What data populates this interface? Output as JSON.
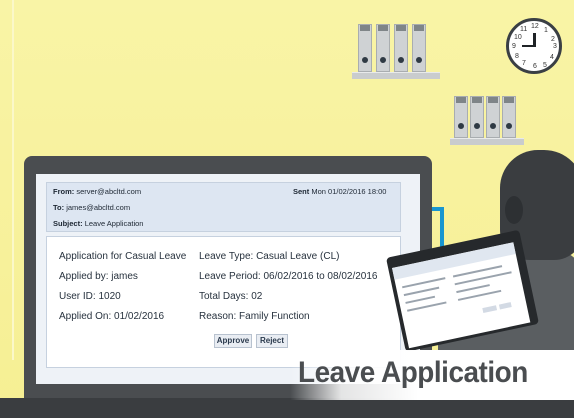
{
  "email": {
    "from_label": "From:",
    "from_value": "server@abcltd.com",
    "sent_label": "Sent",
    "sent_value": "Mon 01/02/2016 18:00",
    "to_label": "To:",
    "to_value": "james@abcltd.com",
    "subject_label": "Subject:",
    "subject_value": "Leave Application"
  },
  "body": {
    "left": [
      "Application for Casual Leave",
      "Applied by: james",
      "User ID: 1020",
      "Applied On: 01/02/2016"
    ],
    "right": [
      "Leave Type: Casual Leave (CL)",
      "Leave Period: 06/02/2016 to 08/02/2016",
      "Total Days: 02",
      "Reason: Family Function"
    ]
  },
  "actions": {
    "approve_label": "Approve",
    "reject_label": "Reject"
  },
  "clock": {
    "numbers": [
      "12",
      "1",
      "2",
      "3",
      "4",
      "5",
      "6",
      "7",
      "8",
      "9",
      "10",
      "11"
    ]
  },
  "banner": {
    "title": "Leave Application"
  },
  "colors": {
    "wall": "#f7f29a",
    "monitor": "#4a4d50",
    "connector": "#1996d0",
    "email_header": "#dde6f2"
  },
  "icons": [
    "clock-icon",
    "binder-icon"
  ]
}
